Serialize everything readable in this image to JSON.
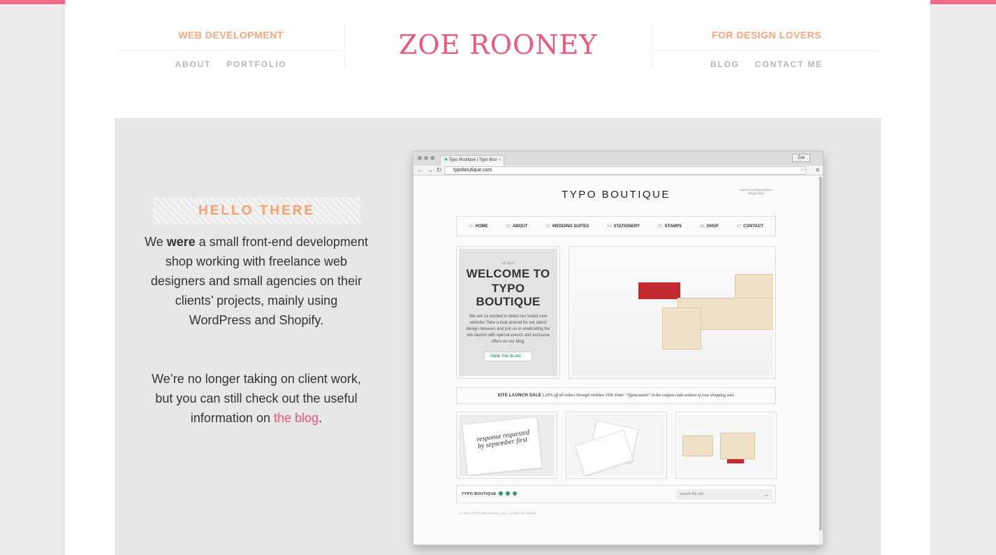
{
  "header": {
    "left_tagline": "WEB DEVELOPMENT",
    "right_tagline": "FOR DESIGN LOVERS",
    "logo": "ZOE ROONEY",
    "nav_left": [
      "ABOUT",
      "PORTFOLIO"
    ],
    "nav_right": [
      "BLOG",
      "CONTACT ME"
    ]
  },
  "hero": {
    "badge": "HELLO THERE",
    "intro": {
      "before": "We ",
      "bold": "were",
      "after": " a small front-end development shop working with freelance web designers and small agencies on their clients’ projects, mainly using WordPress and Shopify."
    },
    "notice": {
      "before": "We’re no longer taking on client work, but you can still check out the useful information on ",
      "link": "the blog",
      "after": "."
    }
  },
  "browser": {
    "tab_title": "Typo Boutique | Typo Bou",
    "tab_close": "×",
    "user": "Zoe",
    "url": "typoboutique.com",
    "site": {
      "title": "TYPO BOUTIQUE",
      "stamp_text": "custom correspondence",
      "stamp_sub": "design blog",
      "nav": [
        {
          "num": "01.",
          "label": "HOME"
        },
        {
          "num": "02.",
          "label": "ABOUT"
        },
        {
          "num": "03.",
          "label": "WEDDING SUITES"
        },
        {
          "num": "04.",
          "label": "STATIONERY"
        },
        {
          "num": "05.",
          "label": "STAMPS"
        },
        {
          "num": "06.",
          "label": "SHOP"
        },
        {
          "num": "07.",
          "label": "CONTACT"
        }
      ],
      "welcome": {
        "at_last": "At last!",
        "title_line1": "WELCOME TO",
        "title_line2": "TYPO BOUTIQUE",
        "body": "We are so excited to debut our brand new website! Take a look around for our latest design releases and join us in celebrating the site launch with special events and exclusive offers on our blog.",
        "button": "VIEW THE BLOG →"
      },
      "sale": {
        "label": "SITE LAUNCH SALE",
        "separator": "|",
        "text": "20% off all orders through October 15th. Enter “TypoLaunch” in the coupon code section of your shopping cart."
      },
      "thumb1_script": "response requested by september first",
      "footer": {
        "brand": "TYPO BOUTIQUE",
        "search_placeholder": "search the site",
        "arrow": "→",
        "copyright": "© 2014 TYPO BOUTIQUE, LLC | CODE BY ZEWO"
      }
    }
  },
  "colors": {
    "accent_pink": "#f0567a",
    "accent_orange": "#f9a67e",
    "nav_gray": "#b7b7b7"
  }
}
